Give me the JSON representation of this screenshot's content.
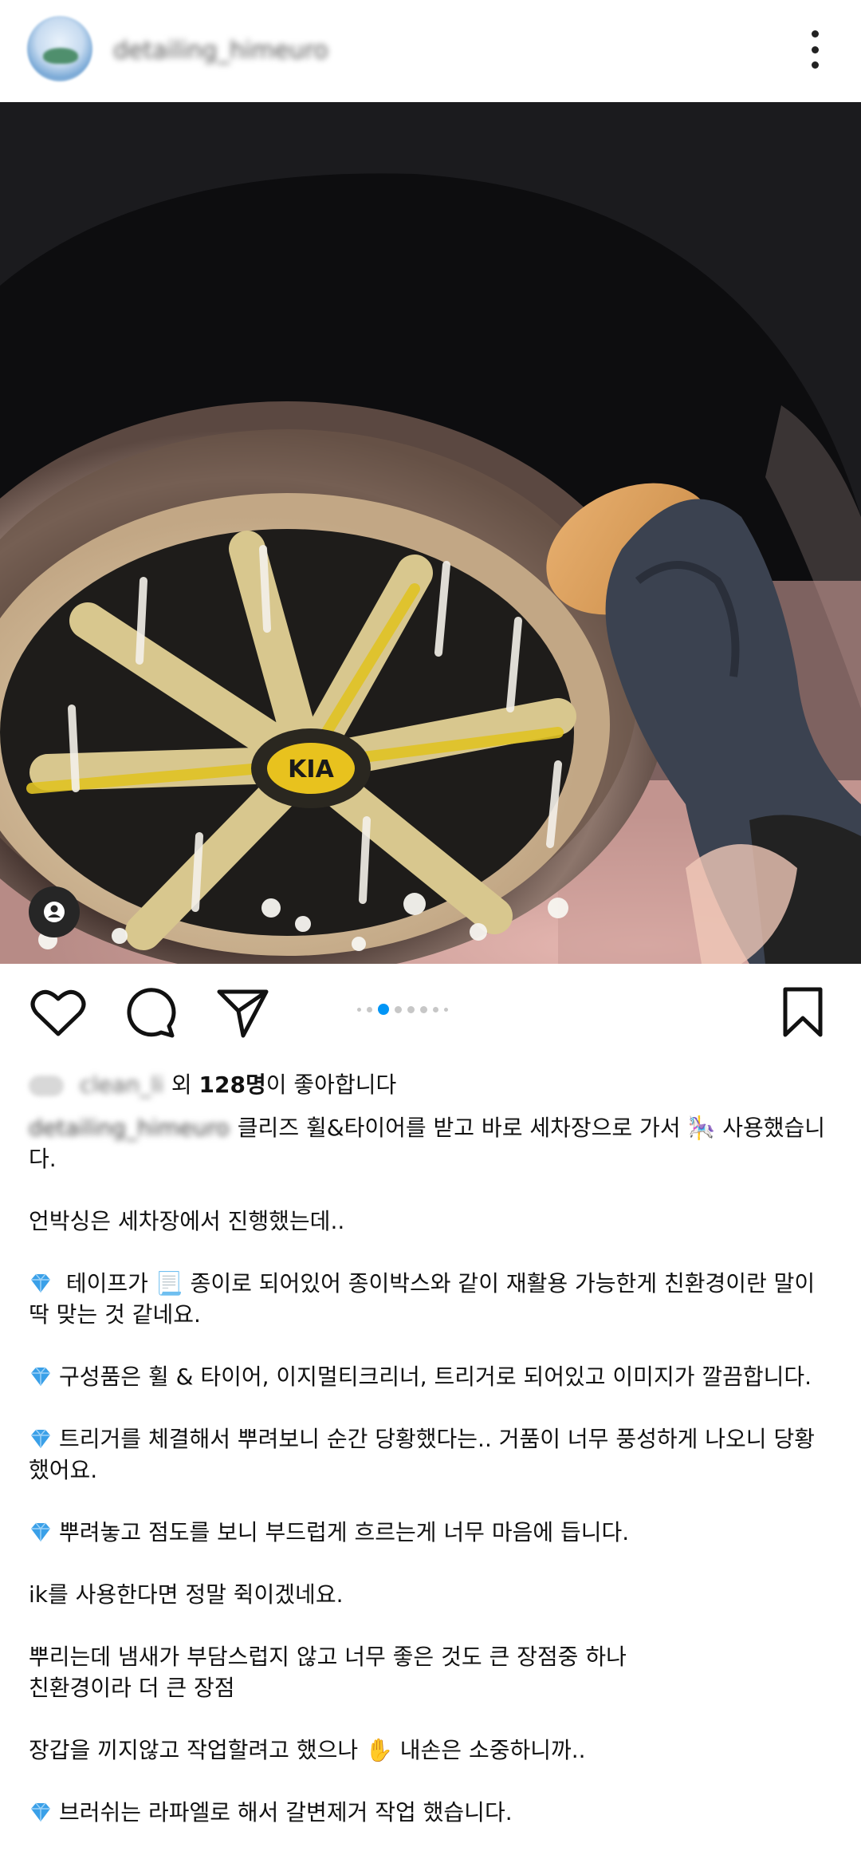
{
  "header": {
    "username": "detailing_himeuro",
    "more_icon": "more-vertical-icon"
  },
  "media": {
    "carousel_index": 2,
    "carousel_count": 7,
    "user_tag_icon": "person-icon"
  },
  "actions": {
    "like_icon": "heart-icon",
    "comment_icon": "speech-bubble-icon",
    "share_icon": "paper-plane-icon",
    "save_icon": "bookmark-icon"
  },
  "likes": {
    "liker": "clean_li",
    "prefix": "외 ",
    "count": "128명",
    "suffix": "이 좋아합니다"
  },
  "caption": {
    "username": "detailing_himeuro",
    "lines": [
      "클리즈 휠&타이어를 받고 바로 세차장으로 가서 🎠 사용했습니다.",
      "언박싱은 세차장에서 진행했는데..",
      "테이프가 📃 종이로 되어있어 종이박스와 같이 재활용 가능한게 친환경이란 말이 딱 맞는 것 같네요.",
      "구성품은 휠 & 타이어, 이지멀티크리너, 트리거로 되어있고 이미지가 깔끔합니다.",
      "트리거를 체결해서 뿌려보니  순간 당황했다는.. 거품이 너무 풍성하게 나오니 당황했어요.",
      "뿌려놓고 점도를 보니 부드럽게 흐르는게 너무 마음에 듭니다.",
      "ik를 사용한다면 정말 쥑이겠네요.",
      "뿌리는데 냄새가 부담스럽지 않고 너무 좋은 것도 큰 장점중 하나\n친환경이라 더 큰 장점",
      "장갑을 끼지않고 작업할려고 했으나 ✋ 내손은 소중하니까..",
      "브러쉬는 라파엘로 해서 갈변제거 작업 했습니다."
    ],
    "bullet_icon": "gem-icon"
  }
}
